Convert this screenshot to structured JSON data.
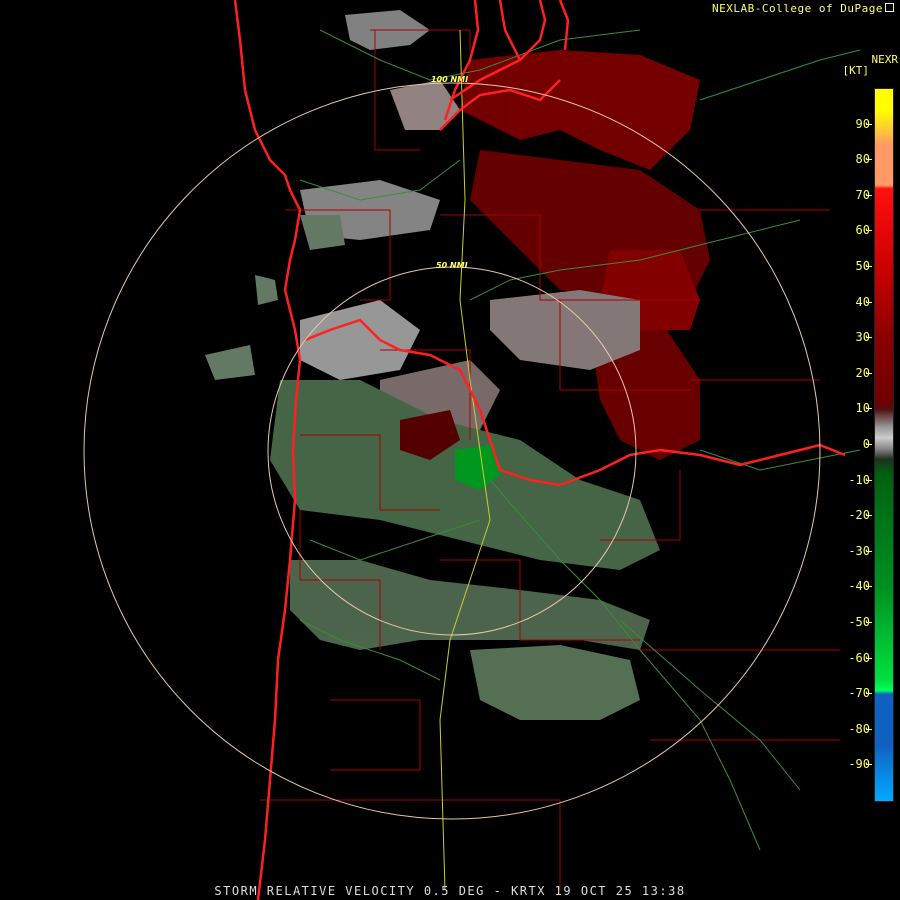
{
  "header": {
    "credit": "NEXLAB-College of DuPage",
    "product": "NEXR",
    "units": "[KT]"
  },
  "legend": {
    "ticks": [
      "90",
      "80",
      "70",
      "60",
      "50",
      "40",
      "30",
      "20",
      "10",
      "0",
      "-10",
      "-20",
      "-30",
      "-40",
      "-50",
      "-60",
      "-70",
      "-80",
      "-90"
    ],
    "range": [
      -100,
      100
    ],
    "colors": {
      "rf": "#00aaff",
      "strong_inbound": "#1060c0",
      "inbound_bright": "#00e040",
      "inbound_mid": "#009020",
      "inbound_dark": "#006010",
      "near_zero": "#aaaaaa",
      "outbound_dark": "#700000",
      "outbound_mid": "#cc0000",
      "outbound_bright": "#ff1010",
      "outbound_strong": "#ff9966",
      "outbound_max": "#ffff00"
    }
  },
  "range_rings": {
    "inner_label": "50 NMI",
    "outer_label": "100 NMI",
    "color": "#e8c8a8"
  },
  "radar": {
    "site": "KRTX",
    "product_text": "STORM RELATIVE VELOCITY 0.5 DEG - KRTX 19 OCT 25 13:38"
  }
}
